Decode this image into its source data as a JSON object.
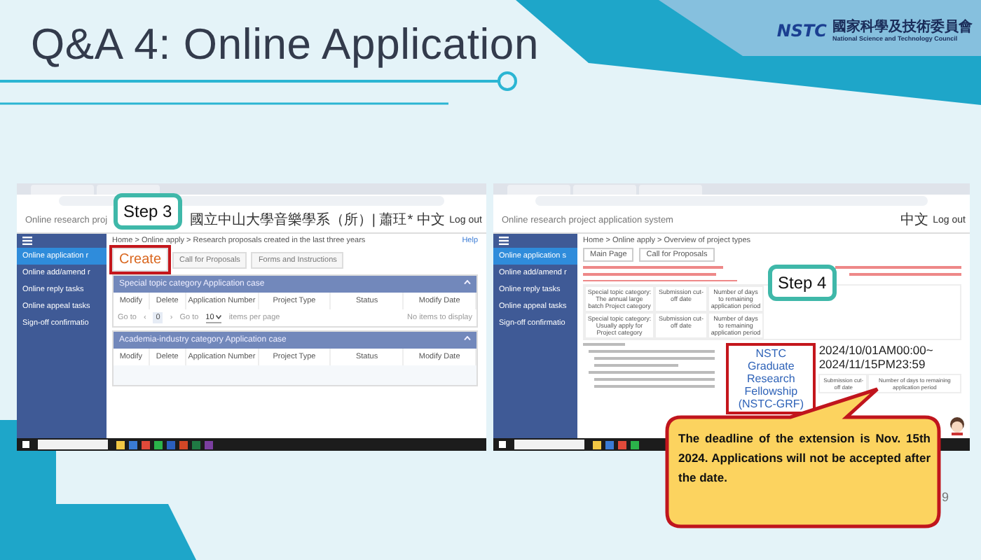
{
  "title": "Q&A 4: Online Application",
  "logo": {
    "mark": "NSTC",
    "name_zh": "國家科學及技術委員會",
    "name_en": "National Science and Technology Council"
  },
  "left_screen": {
    "step": "Step 3",
    "app_title": "Online research proj",
    "user": "國立中山大學音樂學系（所）| 蕭玨*",
    "language": "中文",
    "logout": "Log out",
    "sidebar": [
      {
        "label": "Online application r",
        "selected": true
      },
      {
        "label": "Online add/amend r",
        "selected": false
      },
      {
        "label": "Online reply tasks",
        "selected": false
      },
      {
        "label": "Online appeal tasks",
        "selected": false
      },
      {
        "label": "Sign-off confirmatio",
        "selected": false
      }
    ],
    "breadcrumb": "Home > Online apply > Research proposals created in the last three years",
    "help": "Help",
    "tabs": [
      {
        "label": "Create",
        "selected": true,
        "highlighted": true
      },
      {
        "label": "Call for Proposals",
        "selected": false,
        "highlighted": false
      },
      {
        "label": "Forms and Instructions",
        "selected": false,
        "highlighted": false
      }
    ],
    "panels": [
      {
        "title": "Special topic category Application case",
        "columns": [
          "Modify",
          "Delete",
          "Application Number",
          "Project Type",
          "Status",
          "Modify Date"
        ],
        "pager": {
          "first": "Go to",
          "prev": "‹",
          "page": "0",
          "next": "›",
          "last": "Go to",
          "page_size": "10",
          "page_size_label": "items per page",
          "empty": "No items to display"
        }
      },
      {
        "title": "Academia-industry category Application case",
        "columns": [
          "Modify",
          "Delete",
          "Application Number",
          "Project Type",
          "Status",
          "Modify Date"
        ]
      }
    ]
  },
  "right_screen": {
    "step": "Step 4",
    "app_title": "Online research project application system",
    "language": "中文",
    "logout": "Log out",
    "sidebar": [
      {
        "label": "Online application s",
        "selected": true
      },
      {
        "label": "Online add/amend r",
        "selected": false
      },
      {
        "label": "Online reply tasks",
        "selected": false
      },
      {
        "label": "Online appeal tasks",
        "selected": false
      },
      {
        "label": "Sign-off confirmatio",
        "selected": false
      }
    ],
    "breadcrumb": "Home > Online apply > Overview of project types",
    "buttons": [
      "Main Page",
      "Call for Proposals"
    ],
    "rows": [
      {
        "category": "Special topic category: The annual large batch Project category",
        "cutoff": "Submission cut-off date",
        "days": "Number of days to remaining application period"
      },
      {
        "category": "Special topic category: Usually apply for Project category",
        "cutoff": "Submission cut-off date",
        "days": "Number of days to remaining application period"
      }
    ],
    "featured": {
      "name": "NSTC Graduate Research Fellowship (NSTC-GRF)",
      "period": "2024/10/01AM00:00~2024/11/15PM23:59",
      "cutoff": "Submission cut-off date",
      "days": "Number of days to remaining application period"
    }
  },
  "note": "The deadline of the extension is Nov. 15th 2024.  Applications will not be accepted after the date.",
  "page_number": "9"
}
